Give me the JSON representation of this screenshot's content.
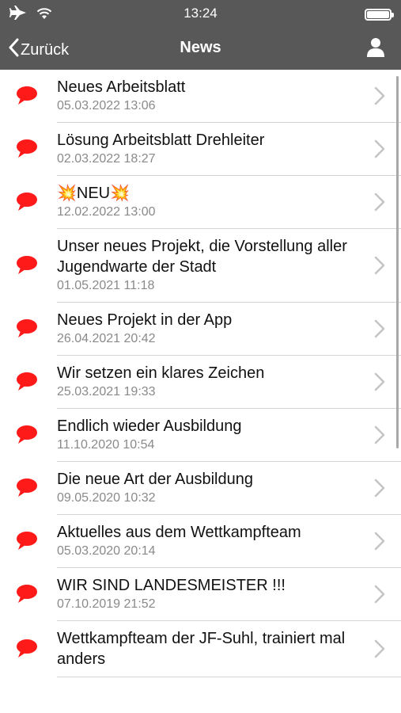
{
  "status_bar": {
    "time": "13:24"
  },
  "nav": {
    "back_label": "Zurück",
    "title": "News"
  },
  "colors": {
    "bar": "#585858",
    "bubble": "#ff1a1a",
    "date": "#8a8a8a"
  },
  "news": [
    {
      "title": "Neues Arbeitsblatt",
      "date": "05.03.2022 13:06"
    },
    {
      "title": "Lösung Arbeitsblatt Drehleiter",
      "date": "02.03.2022 18:27"
    },
    {
      "title": "💥NEU💥",
      "date": "12.02.2022 13:00"
    },
    {
      "title": "Unser neues Projekt, die Vorstellung aller Jugendwarte der Stadt",
      "date": "01.05.2021 11:18"
    },
    {
      "title": "Neues Projekt in der App",
      "date": "26.04.2021 20:42"
    },
    {
      "title": "Wir setzen ein klares Zeichen",
      "date": "25.03.2021 19:33"
    },
    {
      "title": "Endlich wieder Ausbildung",
      "date": "11.10.2020 10:54"
    },
    {
      "title": "Die neue Art der Ausbildung",
      "date": "09.05.2020 10:32"
    },
    {
      "title": "Aktuelles aus dem Wettkampfteam",
      "date": "05.03.2020 20:14"
    },
    {
      "title": "WIR SIND LANDESMEISTER !!!",
      "date": "07.10.2019 21:52"
    },
    {
      "title": "Wettkampfteam der JF-Suhl, trainiert mal anders",
      "date": ""
    }
  ]
}
